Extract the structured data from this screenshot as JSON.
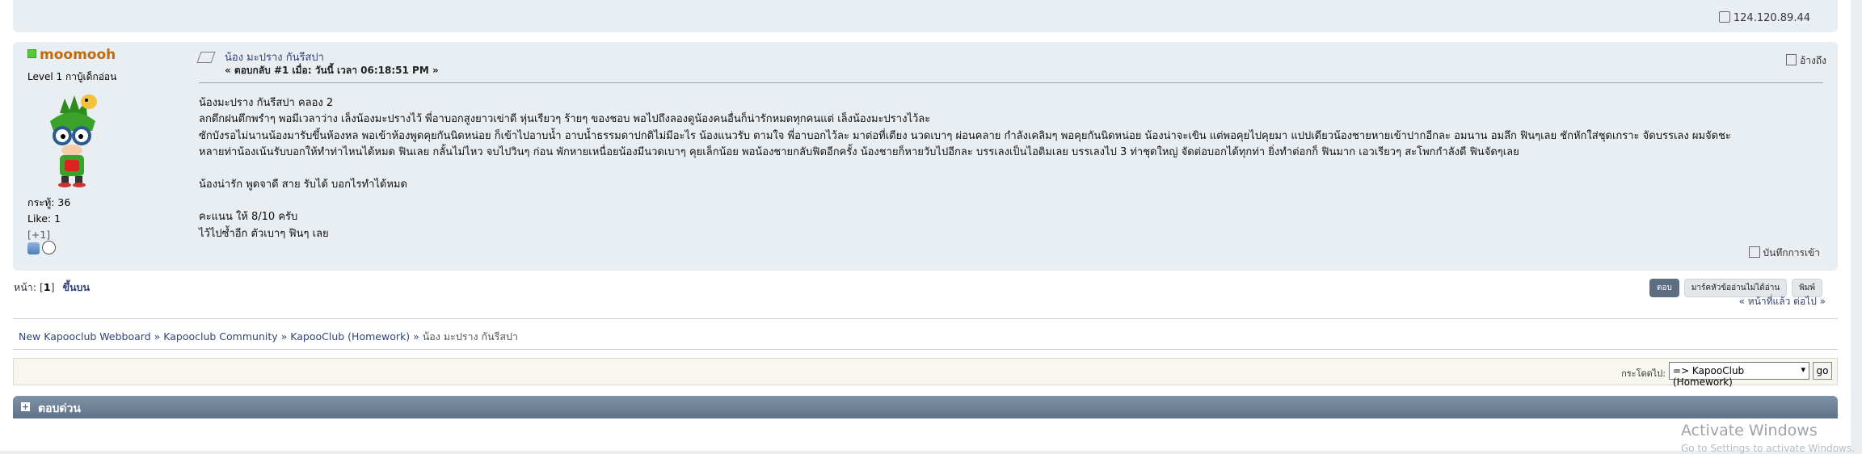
{
  "header": {
    "ip": "124.120.89.44"
  },
  "poster": {
    "username": "moomooh",
    "level": "Level 1 กาบู้เด็กอ่อน",
    "posts": "กระทู้: 36",
    "likes": "Like: 1",
    "plus": "[+1]",
    "online": true
  },
  "post": {
    "subject": "น้อง มะปราง กันรีสปา",
    "meta": "« ตอบกลับ #1 เมื่อ: วันนี้ เวลา 06:18:51 PM »",
    "quote_label": "อ้างถึง",
    "body": [
      "น้องมะปราง กันรีสปา คลอง 2",
      "ลกดึกฝนตึกพรำๆ พอมีเวลาว่าง เล็งน้องมะปรางไว้ พี่อาบอกสูงยาวเข่าดี หุ่นเรียวๆ ร้ายๆ ของชอบ พอไปถึงลองดูน้องคนอื่นก็น่ารักหมดทุกคนแต่ เล็งน้องมะปรางไว้ละ",
      "ซักบังรอไม่นานน้องมารับขึ้นห้องหล พอเข้าห้องพูดคุยกันนิดหน่อย ก็เข้าไปอาบน้ำ อาบน้ำธรรมดาปกติไม่มีอะไร น้องแนวรับ ตามใจ พี่อาบอกไว้ละ มาต่อที่เตียง นวดเบาๆ ผ่อนคลาย กำลังเคลิมๆ พอคุยกันนิดหน่อย น้องน่าจะเขิน แต่พอคุยไปคุยมา แปปเดียวน้องชายหายเข้าปากอีกละ อมนาน อมลึก ฟินๆเลย ชักหักใส่ชุดเกราะ จัดบรรเลง ผมจัดชะ",
      "หลายท่าน้องเน้นรับบอกให้ทำท่าไหนได้หมด ฟินเลย กลั้นไม่ไหว จบไปวินๆ ก่อน พักหายเหนื่อยน้องมีนวดเบาๆ คุยเล็กน้อย พอน้องชายกลับฟิตอีกครั้ง น้องชายก็หายวับไปอีกละ บรรเลงเป็นไอติมเลย  บรรเลงไป 3 ท่าชุดใหญ่  จัดต่อบอกได้ทุกท่า ยิ่งทำต่อกก็ ฟินมาก เอวเรียวๆ สะโพกกำลังดี ฟินจัดๆเลย",
      "",
      "น้องน่ารัก พูดจาดี สาย รับได้ บอกไรทำได้หมด",
      "",
      "คะแนน ให้ 8/10 ครับ",
      "ไว้ไปซ้ำอีก ตัวเบาๆ ฟินๆ เลย"
    ],
    "report_label": "บันทึกการเข้า"
  },
  "pager": {
    "label": "หน้า: [",
    "current": "1",
    "close": "]",
    "up": "ขึ้นบน"
  },
  "buttons": {
    "reply": "ตอบ",
    "mark_unread": "มาร์คหัวข้ออ่านไม่ได้อ่าน",
    "print": "พิมพ์"
  },
  "prevnext": "« หน้าที่แล้ว ต่อไป »",
  "breadcrumb": [
    "New Kapooclub Webboard",
    "Kapooclub Community",
    "KapooClub (Homework)",
    "น้อง มะปราง กันรีสปา"
  ],
  "breadcrumb_sep": "»",
  "jump": {
    "label": "กระโดดไป:",
    "selected": "=> KapooClub (Homework)",
    "go": "go"
  },
  "quick_reply": {
    "title": "ตอบด่วน"
  },
  "watermark": {
    "line1": "Activate Windows",
    "line2": "Go to Settings to activate Windows."
  },
  "colors": {
    "username": "#c06a0c",
    "link": "#334477",
    "post_bg": "#e9eef2",
    "quickreply_bar": "#6a7f94",
    "online": "#55cc33"
  },
  "icons": {
    "ip": "ip-icon",
    "quote": "quote-icon",
    "report": "report-icon",
    "subject": "topic-icon",
    "profile": "profile-icon",
    "pm": "pm-icon"
  }
}
